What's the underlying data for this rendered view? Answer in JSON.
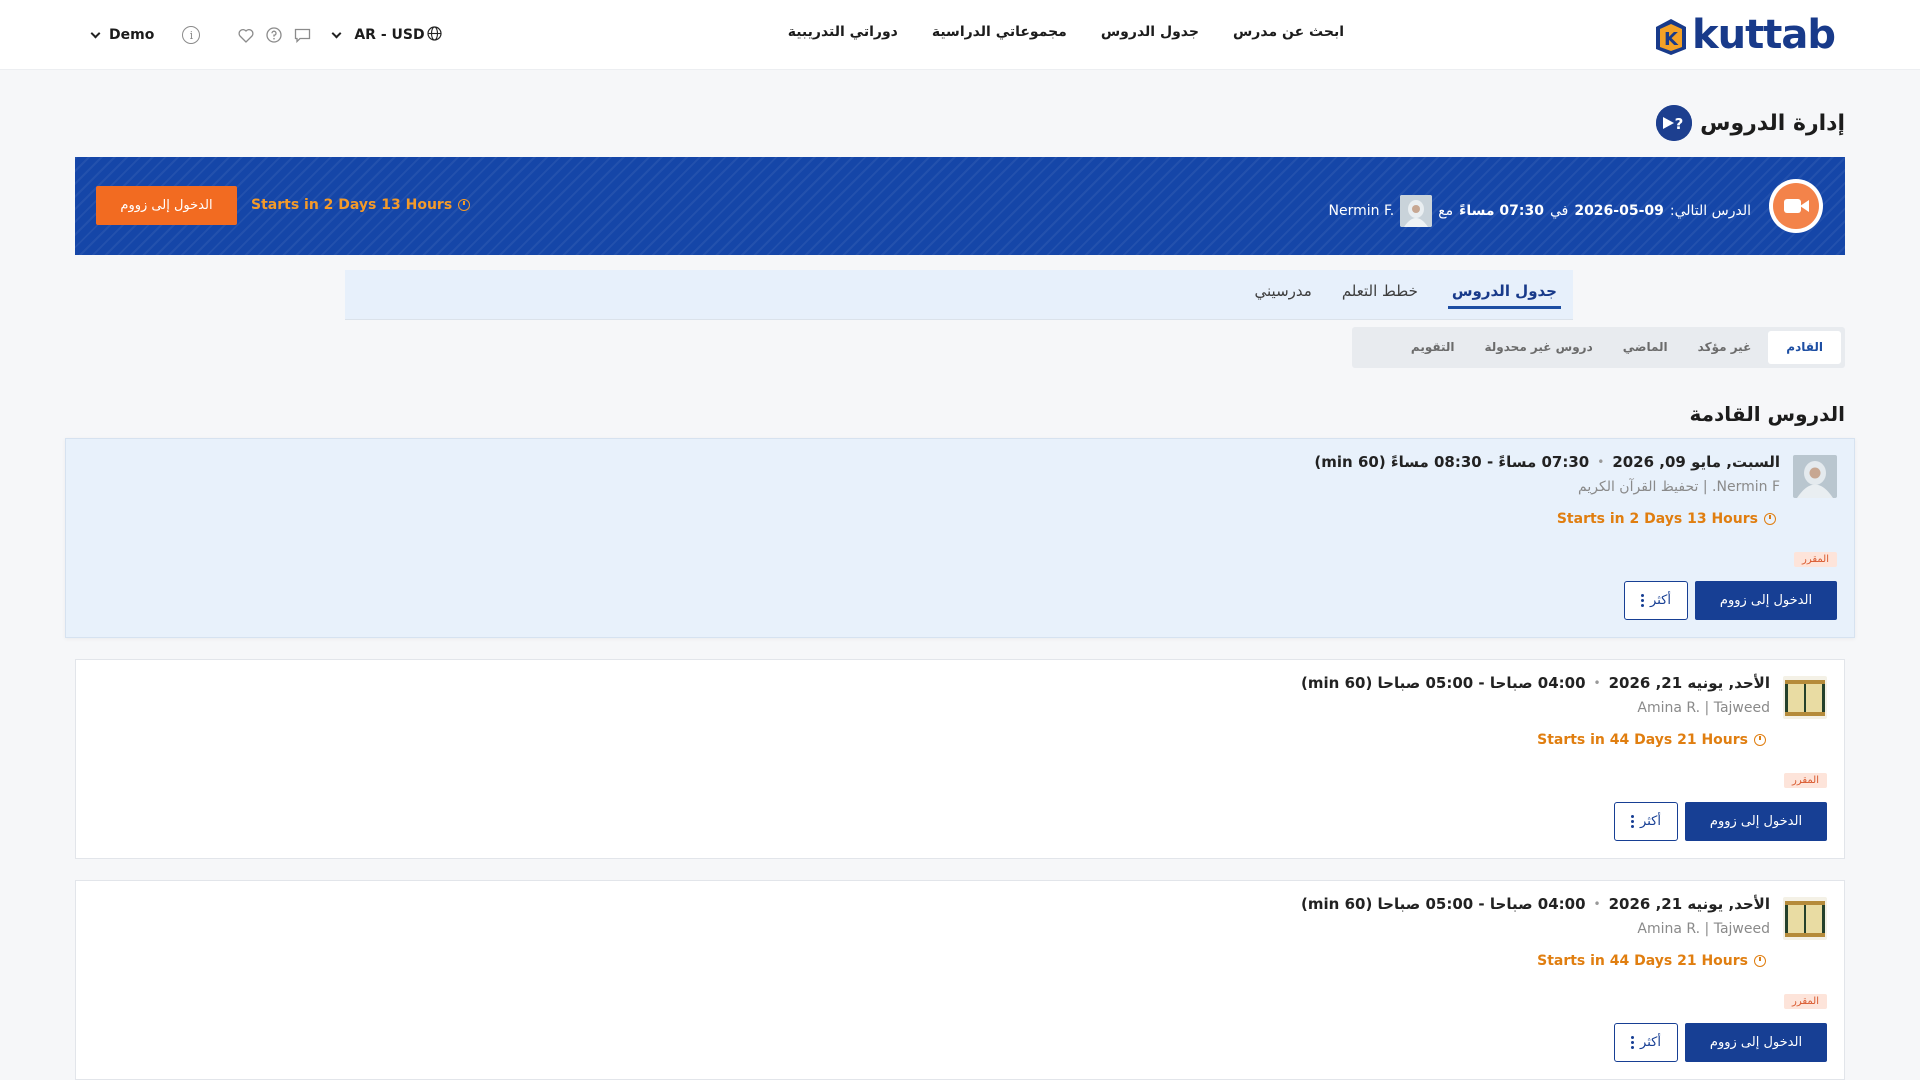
{
  "header": {
    "logo_text": "kuttab",
    "nav": [
      "ابحث عن مدرس",
      "جدول الدروس",
      "مجموعاتي الدراسية",
      "دوراتي التدريبية"
    ],
    "language_currency": "AR - USD",
    "user_label": "Demo",
    "info_glyph": "i"
  },
  "page": {
    "title": "إدارة الدروس"
  },
  "next_lesson": {
    "label": "الدرس التالي:",
    "date": "2026-05-09",
    "in_word": "في",
    "time": "07:30 مساءً",
    "with_word": "مع",
    "teacher": "Nermin F.",
    "starts_in": "Starts in 2 Days 13 Hours",
    "zoom_button": "الدخول إلى زووم"
  },
  "tabs": [
    {
      "label": "جدول الدروس",
      "active": true
    },
    {
      "label": "خطط التعلم",
      "active": false
    },
    {
      "label": "مدرسيني",
      "active": false
    }
  ],
  "subtabs": [
    {
      "label": "القادم",
      "active": true
    },
    {
      "label": "غير مؤكد",
      "active": false
    },
    {
      "label": "الماضي",
      "active": false
    },
    {
      "label": "دروس غير محدولة",
      "active": false
    },
    {
      "label": "التقويم",
      "active": false
    }
  ],
  "section_title": "الدروس القادمة",
  "lessons": [
    {
      "date": "السبت, مايو 09, 2026",
      "time": "07:30 مساءً - 08:30 مساءً (60 min)",
      "teacher_course": "Nermin F. | تحفيظ القرآن الكريم",
      "starts_in": "Starts in 2 Days 13 Hours",
      "status": "المقرر",
      "zoom_button": "الدخول إلى زووم",
      "more_button": "أكثر",
      "thumb": "teacher-avatar"
    },
    {
      "date": "الأحد, يونيه 21, 2026",
      "time": "04:00 صباحا - 05:00 صباحا (60 min)",
      "teacher_course": "Amina R. | Tajweed",
      "starts_in": "Starts in 44 Days 21 Hours",
      "status": "المقرر",
      "zoom_button": "الدخول إلى زووم",
      "more_button": "أكثر",
      "thumb": "quran-book"
    },
    {
      "date": "الأحد, يونيه 21, 2026",
      "time": "04:00 صباحا - 05:00 صباحا (60 min)",
      "teacher_course": "Amina R. | Tajweed",
      "starts_in": "Starts in 44 Days 21 Hours",
      "status": "المقرر",
      "zoom_button": "الدخول إلى زووم",
      "more_button": "أكثر",
      "thumb": "quran-book"
    }
  ],
  "colors": {
    "brand_blue": "#173f94",
    "banner_blue": "#1546a8",
    "orange": "#f26b21",
    "starts_orange": "#e07e10",
    "highlight_bg": "#e8f1fb"
  }
}
